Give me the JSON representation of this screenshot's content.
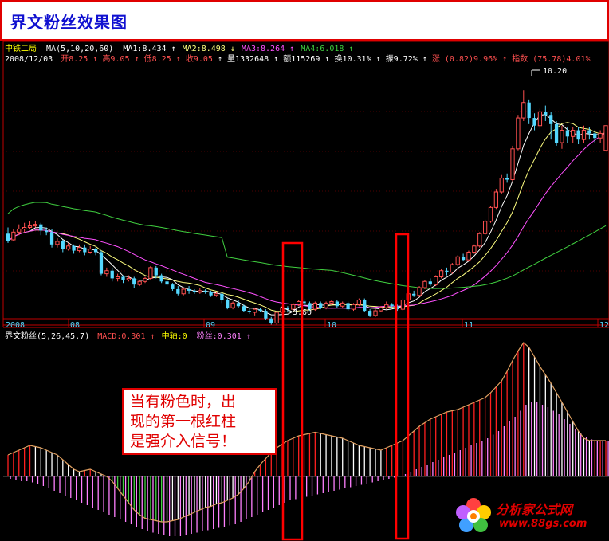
{
  "title": "界文粉丝效果图",
  "price_info": {
    "stock_name": "中铁二局",
    "ma_label": "MA(5,10,20,60)",
    "ma1": "MA1:8.434",
    "ma2": "MA2:8.498",
    "ma3": "MA3:8.264",
    "ma4": "MA4:6.018",
    "date": "2008/12/03",
    "open": "开8.25",
    "high": "高9.05",
    "low": "低8.25",
    "close": "收9.05",
    "volume": "量1332648",
    "amount": "额115269",
    "turnover": "换10.31%",
    "amplitude": "振9.72%",
    "change": "涨 (0.82)9.96%",
    "index": "指数 (75.78)4.01%"
  },
  "indicator_info": {
    "name": "界文粉丝(5,26,45,7)",
    "macd": "MACD:0.301",
    "zhongzhou": "中轴:0",
    "fensi": "粉丝:0.301"
  },
  "annotations": {
    "high_label": "10.20",
    "low_label": "3.60"
  },
  "callout": {
    "line1": "当有粉色时，出",
    "line2": "现的第一根红柱",
    "line3": "是强介入信号！"
  },
  "logo": {
    "title": "分析家公式网",
    "url": "www.88gs.com"
  },
  "colors": {
    "up": "#ff5050",
    "down": "#54d8ff",
    "ma1": "#ffffff",
    "ma2": "#ffff80",
    "ma3": "#ff50ff",
    "ma4": "#40d040",
    "pink": "#ff80ff",
    "red": "#ff2020",
    "green": "#40d040",
    "frame": "#c00000"
  },
  "chart_data": [
    {
      "type": "candlestick",
      "title": "中铁二局",
      "x_ticks": [
        "2008",
        "08",
        "09",
        "10",
        "11",
        "12"
      ],
      "y_range": [
        3.0,
        10.8
      ],
      "bars": [
        [
          5.55,
          5.3,
          5.75,
          5.25
        ],
        [
          5.35,
          5.6,
          5.7,
          5.3
        ],
        [
          5.6,
          5.7,
          5.85,
          5.5
        ],
        [
          5.7,
          5.75,
          5.9,
          5.6
        ],
        [
          5.75,
          5.8,
          5.95,
          5.7
        ],
        [
          5.8,
          5.85,
          5.95,
          5.75
        ],
        [
          5.85,
          5.65,
          5.9,
          5.5
        ],
        [
          5.65,
          5.6,
          5.75,
          5.5
        ],
        [
          5.6,
          5.2,
          5.7,
          5.1
        ],
        [
          5.2,
          5.3,
          5.4,
          5.1
        ],
        [
          5.3,
          5.05,
          5.35,
          4.95
        ],
        [
          5.05,
          5.15,
          5.25,
          5.0
        ],
        [
          5.15,
          5.0,
          5.2,
          4.9
        ],
        [
          5.0,
          5.1,
          5.2,
          4.95
        ],
        [
          5.1,
          4.95,
          5.2,
          4.85
        ],
        [
          4.95,
          5.05,
          5.15,
          4.9
        ],
        [
          5.05,
          4.95,
          5.1,
          4.85
        ],
        [
          4.95,
          4.25,
          5.0,
          4.2
        ],
        [
          4.25,
          4.35,
          4.45,
          4.15
        ],
        [
          4.35,
          4.1,
          4.45,
          4.0
        ],
        [
          4.1,
          4.15,
          4.25,
          4.0
        ],
        [
          4.15,
          4.05,
          4.2,
          3.95
        ],
        [
          4.05,
          4.1,
          4.2,
          4.0
        ],
        [
          4.1,
          3.9,
          4.15,
          3.8
        ],
        [
          3.9,
          4.0,
          4.05,
          3.85
        ],
        [
          4.0,
          4.1,
          4.15,
          3.95
        ],
        [
          4.1,
          4.45,
          4.5,
          4.05
        ],
        [
          4.45,
          4.2,
          4.5,
          4.1
        ],
        [
          4.2,
          4.0,
          4.25,
          3.95
        ],
        [
          4.0,
          3.9,
          4.05,
          3.85
        ],
        [
          3.9,
          3.75,
          3.95,
          3.7
        ],
        [
          3.75,
          3.6,
          3.85,
          3.55
        ],
        [
          3.6,
          3.75,
          3.8,
          3.55
        ],
        [
          3.75,
          3.7,
          3.85,
          3.6
        ],
        [
          3.7,
          3.65,
          3.75,
          3.6
        ],
        [
          3.65,
          3.7,
          3.8,
          3.6
        ],
        [
          3.7,
          3.65,
          3.75,
          3.6
        ],
        [
          3.65,
          3.55,
          3.7,
          3.5
        ],
        [
          3.55,
          3.6,
          3.65,
          3.5
        ],
        [
          3.6,
          3.4,
          3.65,
          3.3
        ],
        [
          3.4,
          3.15,
          3.45,
          3.1
        ],
        [
          3.15,
          3.3,
          3.35,
          3.1
        ],
        [
          3.3,
          3.2,
          3.4,
          3.15
        ],
        [
          3.2,
          3.05,
          3.25,
          3.0
        ],
        [
          3.05,
          3.0,
          3.15,
          2.95
        ],
        [
          3.0,
          3.1,
          3.15,
          2.9
        ],
        [
          3.1,
          3.05,
          3.15,
          3.0
        ],
        [
          3.05,
          2.8,
          3.1,
          2.75
        ],
        [
          2.8,
          2.65,
          2.85,
          2.6
        ],
        [
          2.65,
          3.0,
          3.05,
          2.6
        ],
        [
          3.0,
          3.15,
          3.2,
          2.95
        ],
        [
          3.15,
          3.1,
          3.2,
          3.0
        ],
        [
          3.1,
          3.25,
          3.3,
          3.05
        ],
        [
          3.25,
          3.35,
          3.4,
          3.2
        ],
        [
          3.35,
          3.3,
          3.45,
          3.25
        ],
        [
          3.3,
          3.1,
          3.35,
          3.05
        ],
        [
          3.1,
          3.3,
          3.35,
          3.05
        ],
        [
          3.3,
          3.15,
          3.35,
          3.1
        ],
        [
          3.15,
          3.3,
          3.35,
          3.1
        ],
        [
          3.3,
          3.35,
          3.4,
          3.25
        ],
        [
          3.35,
          3.2,
          3.4,
          3.15
        ],
        [
          3.2,
          3.3,
          3.35,
          3.15
        ],
        [
          3.3,
          3.1,
          3.35,
          3.05
        ],
        [
          3.1,
          3.25,
          3.3,
          3.05
        ],
        [
          3.25,
          3.4,
          3.45,
          3.2
        ],
        [
          3.4,
          3.05,
          3.45,
          3.0
        ],
        [
          3.05,
          2.9,
          3.1,
          2.85
        ],
        [
          2.9,
          3.05,
          3.1,
          2.85
        ],
        [
          3.05,
          3.15,
          3.2,
          3.0
        ],
        [
          3.15,
          3.25,
          3.35,
          3.1
        ],
        [
          3.25,
          3.2,
          3.3,
          3.15
        ],
        [
          3.2,
          3.1,
          3.25,
          3.05
        ],
        [
          3.1,
          3.4,
          3.45,
          3.05
        ],
        [
          3.4,
          3.6,
          3.65,
          3.35
        ],
        [
          3.6,
          3.55,
          3.7,
          3.5
        ],
        [
          3.55,
          3.8,
          3.85,
          3.5
        ],
        [
          3.8,
          4.0,
          4.05,
          3.75
        ],
        [
          4.0,
          3.9,
          4.1,
          3.85
        ],
        [
          3.9,
          4.15,
          4.2,
          3.85
        ],
        [
          4.15,
          4.35,
          4.4,
          4.1
        ],
        [
          4.35,
          4.3,
          4.45,
          4.2
        ],
        [
          4.3,
          4.55,
          4.6,
          4.25
        ],
        [
          4.55,
          4.8,
          4.85,
          4.5
        ],
        [
          4.8,
          4.7,
          4.9,
          4.65
        ],
        [
          4.7,
          4.95,
          5.0,
          4.65
        ],
        [
          4.95,
          5.15,
          5.2,
          4.9
        ],
        [
          5.15,
          5.55,
          5.6,
          5.1
        ],
        [
          5.55,
          5.95,
          6.0,
          5.5
        ],
        [
          5.95,
          6.4,
          6.45,
          5.9
        ],
        [
          6.4,
          6.9,
          7.0,
          6.35
        ],
        [
          6.9,
          7.35,
          7.45,
          6.85
        ],
        [
          7.35,
          7.3,
          7.5,
          7.2
        ],
        [
          7.3,
          8.3,
          8.4,
          7.25
        ],
        [
          8.3,
          9.3,
          9.4,
          8.25
        ],
        [
          9.3,
          9.8,
          10.2,
          9.2
        ],
        [
          9.8,
          9.3,
          9.9,
          9.1
        ],
        [
          9.3,
          9.05,
          9.45,
          8.9
        ],
        [
          9.05,
          9.5,
          9.6,
          8.95
        ],
        [
          9.5,
          9.4,
          9.7,
          9.2
        ],
        [
          9.4,
          9.1,
          9.5,
          8.6
        ],
        [
          9.1,
          8.5,
          9.2,
          8.4
        ],
        [
          8.5,
          8.9,
          9.05,
          8.3
        ],
        [
          8.9,
          8.7,
          9.0,
          8.5
        ],
        [
          8.7,
          8.9,
          9.0,
          8.5
        ],
        [
          8.9,
          8.6,
          9.0,
          8.45
        ],
        [
          8.6,
          8.9,
          9.05,
          8.5
        ],
        [
          8.9,
          8.8,
          9.0,
          8.6
        ],
        [
          8.8,
          8.65,
          8.9,
          8.5
        ],
        [
          8.65,
          8.8,
          8.9,
          8.5
        ],
        [
          8.25,
          9.05,
          9.05,
          8.25
        ]
      ]
    },
    {
      "type": "bar",
      "title": "界文粉丝(5,26,45,7)",
      "series": [
        {
          "name": "MACD",
          "values": [
            0.18,
            0.2,
            0.22,
            0.24,
            0.26,
            0.25,
            0.24,
            0.22,
            0.2,
            0.18,
            0.14,
            0.1,
            0.06,
            0.04,
            0.05,
            0.06,
            0.04,
            0.02,
            0.0,
            -0.04,
            -0.1,
            -0.16,
            -0.22,
            -0.28,
            -0.32,
            -0.35,
            -0.36,
            -0.37,
            -0.38,
            -0.38,
            -0.37,
            -0.36,
            -0.34,
            -0.32,
            -0.3,
            -0.28,
            -0.26,
            -0.25,
            -0.23,
            -0.22,
            -0.2,
            -0.18,
            -0.15,
            -0.1,
            -0.04,
            0.04,
            0.1,
            0.15,
            0.2,
            0.24,
            0.27,
            0.3,
            0.32,
            0.34,
            0.35,
            0.36,
            0.37,
            0.36,
            0.35,
            0.34,
            0.33,
            0.32,
            0.3,
            0.28,
            0.26,
            0.25,
            0.24,
            0.23,
            0.22,
            0.24,
            0.26,
            0.28,
            0.3,
            0.34,
            0.38,
            0.42,
            0.45,
            0.48,
            0.5,
            0.52,
            0.54,
            0.55,
            0.56,
            0.58,
            0.6,
            0.62,
            0.64,
            0.66,
            0.7,
            0.75,
            0.8,
            0.88,
            0.97,
            1.05,
            1.12,
            1.08,
            1.0,
            0.92,
            0.85,
            0.78,
            0.7,
            0.62,
            0.54,
            0.46,
            0.38,
            0.32,
            0.3,
            0.3,
            0.3,
            0.3
          ]
        },
        {
          "name": "粉丝",
          "values": [
            -0.02,
            -0.03,
            -0.04,
            -0.04,
            -0.05,
            -0.06,
            -0.08,
            -0.1,
            -0.12,
            -0.14,
            -0.16,
            -0.18,
            -0.2,
            -0.22,
            -0.24,
            -0.26,
            -0.28,
            -0.3,
            -0.32,
            -0.34,
            -0.36,
            -0.38,
            -0.4,
            -0.42,
            -0.44,
            -0.46,
            -0.47,
            -0.48,
            -0.49,
            -0.5,
            -0.5,
            -0.5,
            -0.49,
            -0.48,
            -0.47,
            -0.46,
            -0.45,
            -0.44,
            -0.43,
            -0.42,
            -0.41,
            -0.4,
            -0.38,
            -0.36,
            -0.34,
            -0.32,
            -0.3,
            -0.28,
            -0.26,
            -0.24,
            -0.22,
            -0.2,
            -0.19,
            -0.18,
            -0.17,
            -0.16,
            -0.15,
            -0.14,
            -0.13,
            -0.12,
            -0.11,
            -0.1,
            -0.09,
            -0.08,
            -0.07,
            -0.06,
            -0.05,
            -0.04,
            -0.03,
            -0.02,
            -0.01,
            0.0,
            0.02,
            0.04,
            0.06,
            0.08,
            0.1,
            0.12,
            0.14,
            0.16,
            0.18,
            0.2,
            0.22,
            0.24,
            0.26,
            0.28,
            0.3,
            0.32,
            0.35,
            0.38,
            0.42,
            0.46,
            0.5,
            0.55,
            0.6,
            0.62,
            0.62,
            0.6,
            0.58,
            0.55,
            0.52,
            0.48,
            0.44,
            0.4,
            0.36,
            0.33,
            0.31,
            0.3,
            0.3,
            0.3
          ]
        },
        {
          "name": "中轴",
          "values": [
            0
          ]
        }
      ]
    }
  ]
}
